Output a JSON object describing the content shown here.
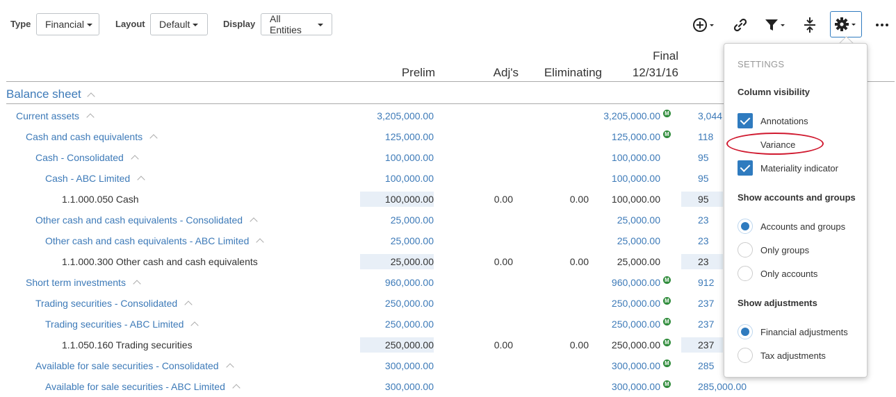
{
  "toolbar": {
    "type_label": "Type",
    "type_value": "Financial",
    "layout_label": "Layout",
    "layout_value": "Default",
    "display_label": "Display",
    "display_value": "All Entities",
    "icons": [
      "add-circle-icon",
      "link-icon",
      "filter-icon",
      "collapse-icon",
      "gear-icon",
      "more-icon"
    ]
  },
  "columns": {
    "prelim": "Prelim",
    "adj": "Adj's",
    "eliminating": "Eliminating",
    "final_top": "Final",
    "final_date": "12/31/16"
  },
  "sheet_title": "Balance sheet",
  "materiality_badge": "M",
  "rows": [
    {
      "label": "Current assets",
      "kind": "group",
      "prelim": "3,205,000.00",
      "adj": "",
      "elim": "",
      "final": "3,205,000.00",
      "badge": true,
      "extra": "3,044"
    },
    {
      "label": "Cash and cash equivalents",
      "kind": "group",
      "prelim": "125,000.00",
      "adj": "",
      "elim": "",
      "final": "125,000.00",
      "badge": true,
      "extra": "118"
    },
    {
      "label": "Cash - Consolidated",
      "kind": "group",
      "prelim": "100,000.00",
      "adj": "",
      "elim": "",
      "final": "100,000.00",
      "badge": false,
      "extra": "95"
    },
    {
      "label": "Cash - ABC Limited",
      "kind": "group",
      "prelim": "100,000.00",
      "adj": "",
      "elim": "",
      "final": "100,000.00",
      "badge": false,
      "extra": "95"
    },
    {
      "label": "1.1.000.050 Cash",
      "kind": "acct",
      "prelim": "100,000.00",
      "adj": "0.00",
      "elim": "0.00",
      "final": "100,000.00",
      "badge": false,
      "extra": "95"
    },
    {
      "label": "Other cash and cash equivalents - Consolidated",
      "kind": "group",
      "prelim": "25,000.00",
      "adj": "",
      "elim": "",
      "final": "25,000.00",
      "badge": false,
      "extra": "23"
    },
    {
      "label": "Other cash and cash equivalents - ABC Limited",
      "kind": "group",
      "prelim": "25,000.00",
      "adj": "",
      "elim": "",
      "final": "25,000.00",
      "badge": false,
      "extra": "23"
    },
    {
      "label": "1.1.000.300 Other cash and cash equivalents",
      "kind": "acct",
      "prelim": "25,000.00",
      "adj": "0.00",
      "elim": "0.00",
      "final": "25,000.00",
      "badge": false,
      "extra": "23"
    },
    {
      "label": "Short term investments",
      "kind": "group",
      "prelim": "960,000.00",
      "adj": "",
      "elim": "",
      "final": "960,000.00",
      "badge": true,
      "extra": "912"
    },
    {
      "label": "Trading securities - Consolidated",
      "kind": "group",
      "prelim": "250,000.00",
      "adj": "",
      "elim": "",
      "final": "250,000.00",
      "badge": true,
      "extra": "237"
    },
    {
      "label": "Trading securities - ABC Limited",
      "kind": "group",
      "prelim": "250,000.00",
      "adj": "",
      "elim": "",
      "final": "250,000.00",
      "badge": true,
      "extra": "237"
    },
    {
      "label": "1.1.050.160 Trading securities",
      "kind": "acct",
      "prelim": "250,000.00",
      "adj": "0.00",
      "elim": "0.00",
      "final": "250,000.00",
      "badge": true,
      "extra": "237"
    },
    {
      "label": "Available for sale securities - Consolidated",
      "kind": "group",
      "prelim": "300,000.00",
      "adj": "",
      "elim": "",
      "final": "300,000.00",
      "badge": true,
      "extra": "285"
    },
    {
      "label": "Available for sale securities - ABC Limited",
      "kind": "group",
      "prelim": "300,000.00",
      "adj": "",
      "elim": "",
      "final": "300,000.00",
      "badge": true,
      "extra": "285,000.00"
    }
  ],
  "settings": {
    "title": "SETTINGS",
    "column_visibility": "Column visibility",
    "annotations": "Annotations",
    "variance": "Variance",
    "materiality_indicator": "Materiality indicator",
    "show_accounts_groups": "Show accounts and groups",
    "accounts_and_groups": "Accounts and groups",
    "only_groups": "Only groups",
    "only_accounts": "Only accounts",
    "show_adjustments": "Show adjustments",
    "financial_adjustments": "Financial adjustments",
    "tax_adjustments": "Tax adjustments"
  },
  "colors": {
    "accent": "#2f7bbf",
    "group_text": "#3d7ab8",
    "highlight_oval": "#d0192f",
    "badge": "#2e8b3a"
  }
}
